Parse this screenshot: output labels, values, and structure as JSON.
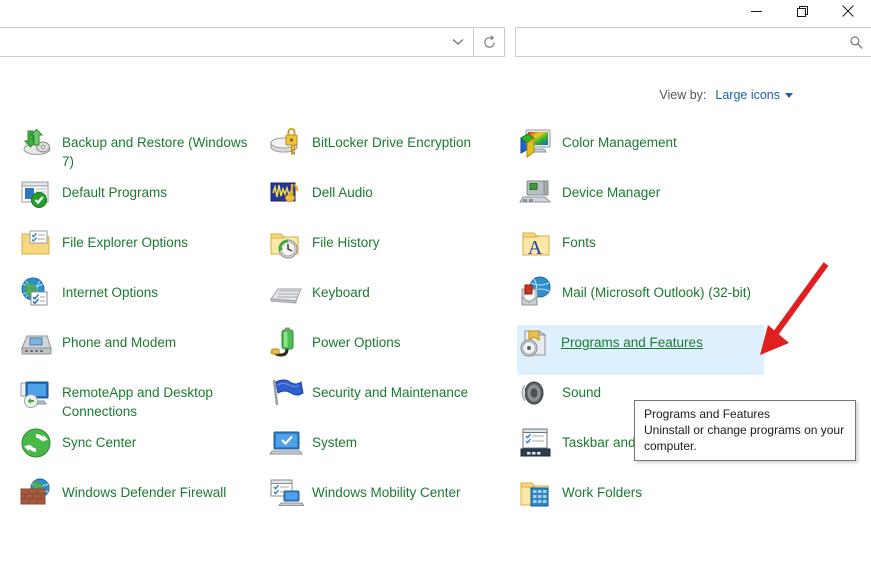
{
  "window": {
    "controls": [
      {
        "name": "minimize",
        "glyph": "minimize-icon"
      },
      {
        "name": "restore",
        "glyph": "restore-icon"
      },
      {
        "name": "close",
        "glyph": "close-icon"
      }
    ]
  },
  "toolbar": {
    "address_value": "",
    "address_placeholder": "",
    "dropdown_icon": "chevron-down-icon",
    "refresh_icon": "refresh-icon",
    "search_value": "",
    "search_placeholder": "",
    "search_icon": "search-icon"
  },
  "viewby": {
    "label": "View by:",
    "value": "Large icons",
    "caret_icon": "chevron-down-icon"
  },
  "colors": {
    "item_text": "#1a7a2e",
    "link_blue": "#1a5fb4",
    "selection_bg": "#def0fd",
    "annotation_red": "#e02020",
    "tooltip_border": "#767676"
  },
  "columns": [
    {
      "id": "column-1",
      "items": [
        {
          "label": "Backup and Restore (Windows 7)",
          "icon": "backup-and-restore-icon",
          "selected": false
        },
        {
          "label": "Default Programs",
          "icon": "default-programs-icon",
          "selected": false
        },
        {
          "label": "File Explorer Options",
          "icon": "file-explorer-options-icon",
          "selected": false
        },
        {
          "label": "Internet Options",
          "icon": "internet-options-icon",
          "selected": false
        },
        {
          "label": "Phone and Modem",
          "icon": "phone-and-modem-icon",
          "selected": false
        },
        {
          "label": "RemoteApp and Desktop Connections",
          "icon": "remoteapp-icon",
          "selected": false
        },
        {
          "label": "Sync Center",
          "icon": "sync-center-icon",
          "selected": false
        },
        {
          "label": "Windows Defender Firewall",
          "icon": "windows-defender-firewall-icon",
          "selected": false
        }
      ]
    },
    {
      "id": "column-2",
      "items": [
        {
          "label": "BitLocker Drive Encryption",
          "icon": "bitlocker-icon",
          "selected": false
        },
        {
          "label": "Dell Audio",
          "icon": "dell-audio-icon",
          "selected": false
        },
        {
          "label": "File History",
          "icon": "file-history-icon",
          "selected": false
        },
        {
          "label": "Keyboard",
          "icon": "keyboard-icon",
          "selected": false
        },
        {
          "label": "Power Options",
          "icon": "power-options-icon",
          "selected": false
        },
        {
          "label": "Security and Maintenance",
          "icon": "security-and-maintenance-icon",
          "selected": false
        },
        {
          "label": "System",
          "icon": "system-icon",
          "selected": false
        },
        {
          "label": "Windows Mobility Center",
          "icon": "windows-mobility-center-icon",
          "selected": false
        }
      ]
    },
    {
      "id": "column-3",
      "items": [
        {
          "label": "Color Management",
          "icon": "color-management-icon",
          "selected": false
        },
        {
          "label": "Device Manager",
          "icon": "device-manager-icon",
          "selected": false
        },
        {
          "label": "Fonts",
          "icon": "fonts-icon",
          "selected": false
        },
        {
          "label": "Mail (Microsoft Outlook) (32-bit)",
          "icon": "mail-outlook-icon",
          "selected": false
        },
        {
          "label": "Programs and Features",
          "icon": "programs-and-features-icon",
          "selected": true
        },
        {
          "label": "Sound",
          "icon": "sound-icon",
          "selected": false
        },
        {
          "label": "Taskbar and Navigation",
          "icon": "taskbar-and-navigation-icon",
          "selected": false
        },
        {
          "label": "Work Folders",
          "icon": "work-folders-icon",
          "selected": false
        }
      ]
    }
  ],
  "tooltip": {
    "title": "Programs and Features",
    "body": "Uninstall or change programs on your computer."
  }
}
